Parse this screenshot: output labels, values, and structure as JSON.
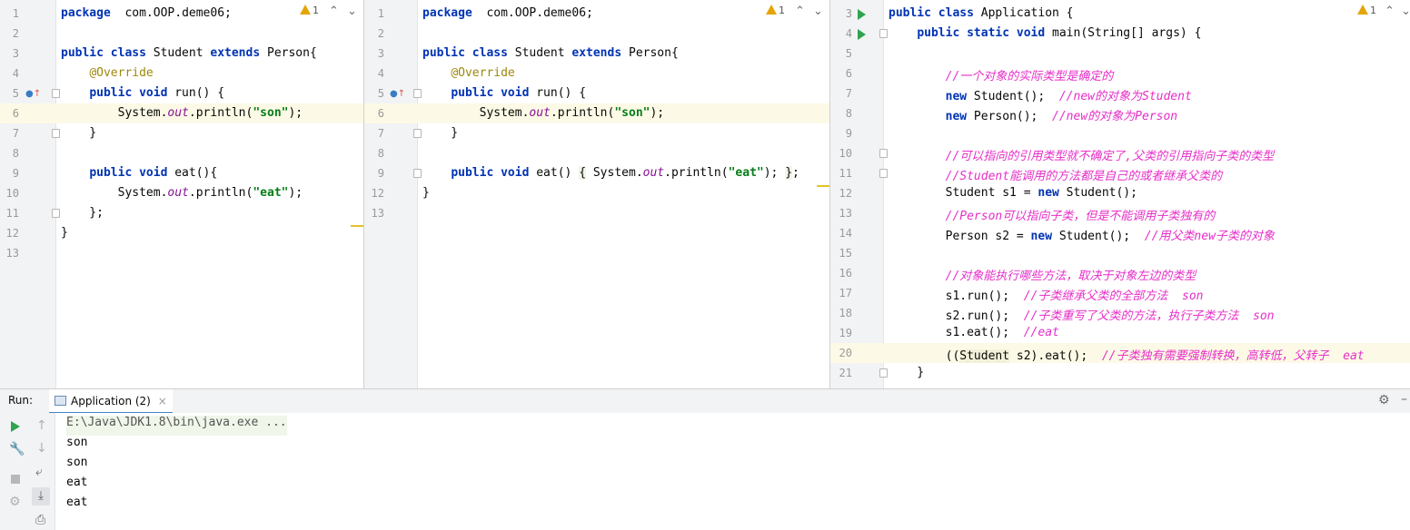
{
  "pane1": {
    "lines": [
      {
        "n": "1",
        "segs": [
          [
            "kw",
            "package"
          ],
          [
            "",
            "  com.OOP.deme06;"
          ]
        ]
      },
      {
        "n": "2",
        "segs": []
      },
      {
        "n": "3",
        "segs": [
          [
            "kw",
            "public class"
          ],
          [
            "",
            " Student "
          ],
          [
            "kw",
            "extends"
          ],
          [
            "",
            " Person{"
          ]
        ]
      },
      {
        "n": "4",
        "segs": [
          [
            "",
            "    "
          ],
          [
            "ann",
            "@Override"
          ]
        ]
      },
      {
        "n": "5",
        "segs": [
          [
            "",
            "    "
          ],
          [
            "kw",
            "public void"
          ],
          [
            "",
            " run() {"
          ]
        ]
      },
      {
        "n": "6",
        "segs": [
          [
            "",
            "        System."
          ],
          [
            "it",
            "out"
          ],
          [
            "",
            ".println("
          ],
          [
            "str",
            "\"son\""
          ],
          [
            "",
            ");"
          ]
        ]
      },
      {
        "n": "7",
        "segs": [
          [
            "",
            "    }"
          ]
        ]
      },
      {
        "n": "8",
        "segs": []
      },
      {
        "n": "9",
        "segs": [
          [
            "",
            "    "
          ],
          [
            "kw",
            "public void"
          ],
          [
            "",
            " eat(){"
          ]
        ]
      },
      {
        "n": "10",
        "segs": [
          [
            "",
            "        System."
          ],
          [
            "it",
            "out"
          ],
          [
            "",
            ".println("
          ],
          [
            "str",
            "\"eat\""
          ],
          [
            "",
            ");"
          ]
        ]
      },
      {
        "n": "11",
        "segs": [
          [
            "",
            "    };"
          ]
        ]
      },
      {
        "n": "12",
        "segs": [
          [
            "",
            "}"
          ]
        ]
      },
      {
        "n": "13",
        "segs": []
      }
    ],
    "warning_count": "1"
  },
  "pane2": {
    "lines": [
      {
        "n": "1",
        "segs": [
          [
            "kw",
            "package"
          ],
          [
            "",
            "  com.OOP.deme06;"
          ]
        ]
      },
      {
        "n": "2",
        "segs": []
      },
      {
        "n": "3",
        "segs": [
          [
            "kw",
            "public class"
          ],
          [
            "",
            " Student "
          ],
          [
            "kw",
            "extends"
          ],
          [
            "",
            " Person{"
          ]
        ]
      },
      {
        "n": "4",
        "segs": [
          [
            "",
            "    "
          ],
          [
            "ann",
            "@Override"
          ]
        ]
      },
      {
        "n": "5",
        "segs": [
          [
            "",
            "    "
          ],
          [
            "kw",
            "public void"
          ],
          [
            "",
            " run() {"
          ]
        ]
      },
      {
        "n": "6",
        "segs": [
          [
            "",
            "        System."
          ],
          [
            "it",
            "out"
          ],
          [
            "",
            ".println("
          ],
          [
            "str",
            "\"son\""
          ],
          [
            "",
            ");"
          ]
        ]
      },
      {
        "n": "7",
        "segs": [
          [
            "",
            "    }"
          ]
        ]
      },
      {
        "n": "8",
        "segs": []
      },
      {
        "n": "9",
        "segs": [
          [
            "",
            "    "
          ],
          [
            "kw",
            "public void"
          ],
          [
            "",
            " eat() "
          ],
          [
            "ev",
            "{"
          ],
          [
            "",
            " System."
          ],
          [
            "it",
            "out"
          ],
          [
            "",
            ".println("
          ],
          [
            "str",
            "\"eat\""
          ],
          [
            "",
            "); "
          ],
          [
            "ev",
            "}"
          ],
          [
            "",
            ";"
          ]
        ]
      },
      {
        "n": "12",
        "segs": [
          [
            "",
            "}"
          ]
        ]
      },
      {
        "n": "13",
        "segs": []
      }
    ],
    "warning_count": "1"
  },
  "pane3": {
    "lines": [
      {
        "n": "3",
        "segs": [
          [
            "kw",
            "public class"
          ],
          [
            "",
            " Application {"
          ]
        ]
      },
      {
        "n": "4",
        "segs": [
          [
            "",
            "    "
          ],
          [
            "kw",
            "public static void"
          ],
          [
            "",
            " main(String[] args) {"
          ]
        ]
      },
      {
        "n": "5",
        "segs": []
      },
      {
        "n": "6",
        "segs": [
          [
            "",
            "        "
          ],
          [
            "cm",
            "//一个对象的实际类型是确定的"
          ]
        ]
      },
      {
        "n": "7",
        "segs": [
          [
            "",
            "        "
          ],
          [
            "kw",
            "new"
          ],
          [
            "",
            " Student();  "
          ],
          [
            "cm",
            "//new的对象为Student"
          ]
        ]
      },
      {
        "n": "8",
        "segs": [
          [
            "",
            "        "
          ],
          [
            "kw",
            "new"
          ],
          [
            "",
            " Person();  "
          ],
          [
            "cm",
            "//new的对象为Person"
          ]
        ]
      },
      {
        "n": "9",
        "segs": []
      },
      {
        "n": "10",
        "segs": [
          [
            "",
            "        "
          ],
          [
            "cm",
            "//可以指向的引用类型就不确定了,父类的引用指向子类的类型"
          ]
        ]
      },
      {
        "n": "11",
        "segs": [
          [
            "",
            "        "
          ],
          [
            "cm",
            "//Student能调用的方法都是自己的或者继承父类的"
          ]
        ]
      },
      {
        "n": "12",
        "segs": [
          [
            "",
            "        Student s1 = "
          ],
          [
            "kw",
            "new"
          ],
          [
            "",
            " Student();"
          ]
        ]
      },
      {
        "n": "13",
        "segs": [
          [
            "",
            "        "
          ],
          [
            "cm",
            "//Person可以指向子类，但是不能调用子类独有的"
          ]
        ]
      },
      {
        "n": "14",
        "segs": [
          [
            "",
            "        Person s2 = "
          ],
          [
            "kw",
            "new"
          ],
          [
            "",
            " Student();  "
          ],
          [
            "cm",
            "//用父类new子类的对象"
          ]
        ]
      },
      {
        "n": "15",
        "segs": []
      },
      {
        "n": "16",
        "segs": [
          [
            "",
            "        "
          ],
          [
            "cm",
            "//对象能执行哪些方法，取决于对象左边的类型"
          ]
        ]
      },
      {
        "n": "17",
        "segs": [
          [
            "",
            "        s1.run();  "
          ],
          [
            "cm",
            "//子类继承父类的全部方法  son"
          ]
        ]
      },
      {
        "n": "18",
        "segs": [
          [
            "",
            "        s2.run();  "
          ],
          [
            "cm",
            "//子类重写了父类的方法，执行子类方法  son"
          ]
        ]
      },
      {
        "n": "19",
        "segs": [
          [
            "",
            "        s1.eat();  "
          ],
          [
            "cm",
            "//eat"
          ]
        ]
      },
      {
        "n": "20",
        "segs": [
          [
            "",
            "        (("
          ],
          [
            "ref",
            "Student"
          ],
          [
            "",
            " s2).eat();  "
          ],
          [
            "cm",
            "//子类独有需要强制转换，高转低，父转子  eat"
          ]
        ]
      },
      {
        "n": "21",
        "segs": [
          [
            "",
            "    }"
          ]
        ]
      }
    ],
    "warning_count": "1"
  },
  "run": {
    "label": "Run:",
    "tab_label": "Application (2)",
    "tab_close": "×",
    "console_lines": [
      "E:\\Java\\JDK1.8\\bin\\java.exe ...",
      "son",
      "son",
      "eat",
      "eat"
    ]
  },
  "colors": {
    "keyword": "#0033b3",
    "string": "#067d17",
    "comment": "#e62ec8",
    "annotation": "#9e880d"
  }
}
